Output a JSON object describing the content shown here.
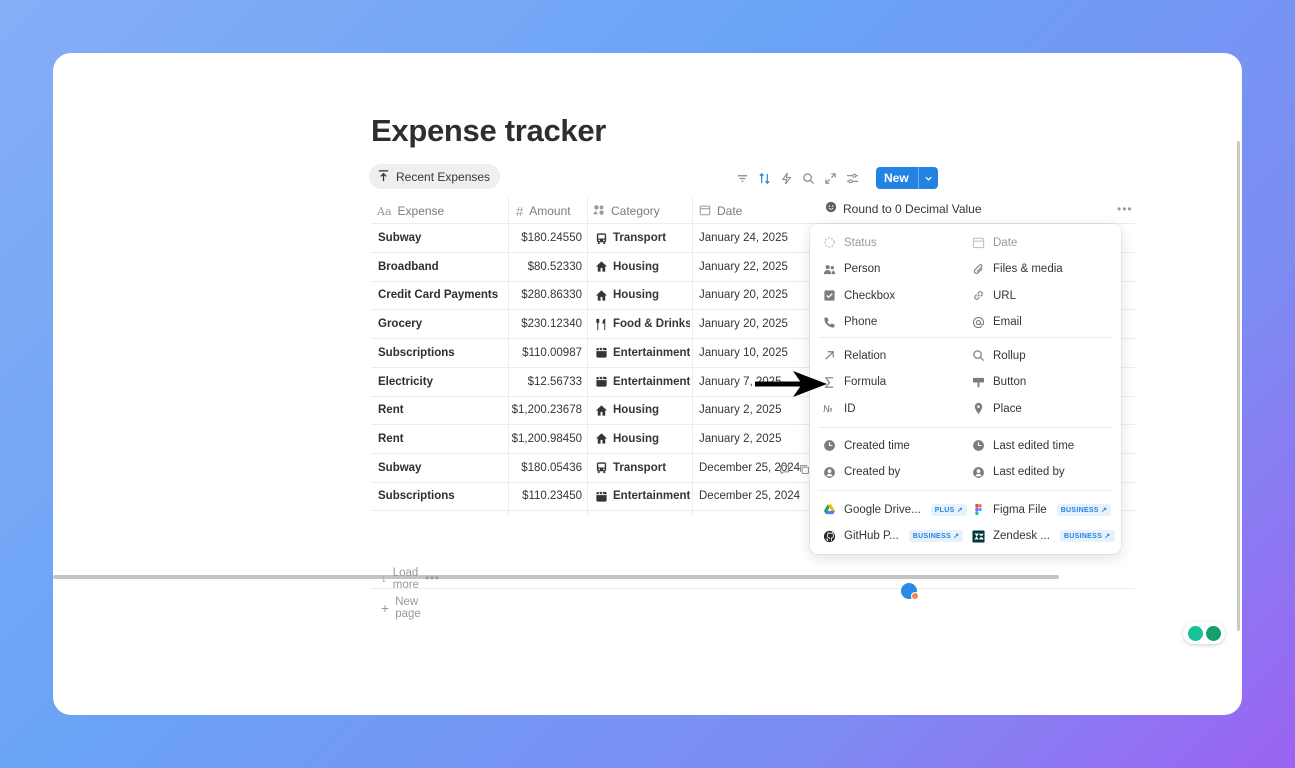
{
  "page": {
    "title": "Expense tracker"
  },
  "view": {
    "tab_label": "Recent Expenses"
  },
  "toolbar": {
    "new_label": "New"
  },
  "columns": {
    "expense": "Expense",
    "amount": "Amount",
    "category": "Category",
    "date": "Date",
    "property_name": "Round to 0 Decimal Value"
  },
  "rows": [
    {
      "expense": "Subway",
      "amount": "$180.24550",
      "category": "Transport",
      "cat_icon": "bus-icon",
      "date": "January 24, 2025"
    },
    {
      "expense": "Broadband",
      "amount": "$80.52330",
      "category": "Housing",
      "cat_icon": "house-icon",
      "date": "January 22, 2025"
    },
    {
      "expense": "Credit Card Payments",
      "amount": "$280.86330",
      "category": "Housing",
      "cat_icon": "house-icon",
      "date": "January 20, 2025"
    },
    {
      "expense": "Grocery",
      "amount": "$230.12340",
      "category": "Food & Drinks",
      "cat_icon": "fork-knife-icon",
      "date": "January 20, 2025"
    },
    {
      "expense": "Subscriptions",
      "amount": "$110.00987",
      "category": "Entertainment",
      "cat_icon": "clapper-icon",
      "date": "January 10, 2025"
    },
    {
      "expense": "Electricity",
      "amount": "$12.56733",
      "category": "Entertainment",
      "cat_icon": "clapper-icon",
      "date": "January 7, 2025"
    },
    {
      "expense": "Rent",
      "amount": "$1,200.23678",
      "category": "Housing",
      "cat_icon": "house-icon",
      "date": "January 2, 2025"
    },
    {
      "expense": "Rent",
      "amount": "$1,200.98450",
      "category": "Housing",
      "cat_icon": "house-icon",
      "date": "January 2, 2025"
    },
    {
      "expense": "Subway",
      "amount": "$180.05436",
      "category": "Transport",
      "cat_icon": "bus-icon",
      "date": "December 25, 2024"
    },
    {
      "expense": "Subscriptions",
      "amount": "$110.23450",
      "category": "Entertainment",
      "cat_icon": "clapper-icon",
      "date": "December 25, 2024"
    }
  ],
  "footer": {
    "load_more": "Load more",
    "new_page": "New page"
  },
  "property_menu": {
    "basic": [
      {
        "label": "Status",
        "icon": "status-icon"
      },
      {
        "label": "Date",
        "icon": "calendar-icon"
      },
      {
        "label": "Person",
        "icon": "people-icon"
      },
      {
        "label": "Files & media",
        "icon": "paperclip-icon"
      },
      {
        "label": "Checkbox",
        "icon": "checkbox-icon"
      },
      {
        "label": "URL",
        "icon": "link-icon"
      },
      {
        "label": "Phone",
        "icon": "phone-icon"
      },
      {
        "label": "Email",
        "icon": "at-icon"
      }
    ],
    "advanced": [
      {
        "label": "Relation",
        "icon": "relation-arrow-icon"
      },
      {
        "label": "Rollup",
        "icon": "magnifier-icon"
      },
      {
        "label": "Formula",
        "icon": "sigma-icon"
      },
      {
        "label": "Button",
        "icon": "button-icon"
      },
      {
        "label": "ID",
        "icon": "numero-icon"
      },
      {
        "label": "Place",
        "icon": "pin-icon"
      }
    ],
    "meta": [
      {
        "label": "Created time",
        "icon": "clock-icon"
      },
      {
        "label": "Last edited time",
        "icon": "clock-icon"
      },
      {
        "label": "Created by",
        "icon": "user-circle-icon"
      },
      {
        "label": "Last edited by",
        "icon": "user-circle-icon"
      }
    ],
    "integrations": [
      {
        "label": "Google Drive...",
        "badge": "PLUS ↗",
        "icon": "google-drive-icon"
      },
      {
        "label": "Figma File",
        "badge": "BUSINESS ↗",
        "icon": "figma-icon"
      },
      {
        "label": "GitHub P...",
        "badge": "BUSINESS ↗",
        "icon": "github-icon"
      },
      {
        "label": "Zendesk ...",
        "badge": "BUSINESS ↗",
        "icon": "zendesk-icon"
      }
    ]
  },
  "colors": {
    "accent": "#2383e2",
    "text": "#37352f",
    "muted": "#9b9a97"
  }
}
